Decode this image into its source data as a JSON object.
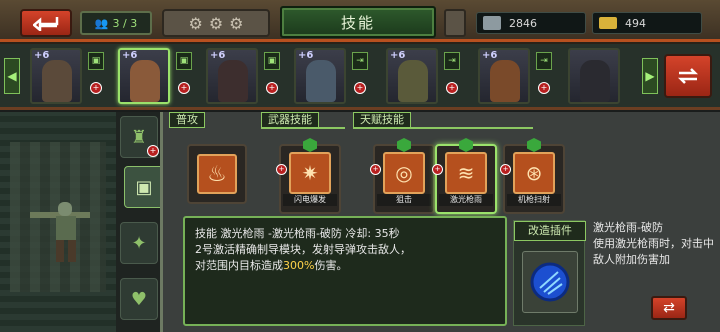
{
  "header": {
    "title": "技能",
    "squad_count": "3 / 3",
    "resources": [
      {
        "icon": "ammo-icon",
        "value": "2846"
      },
      {
        "icon": "gold-bar-icon",
        "value": "494"
      }
    ]
  },
  "heroes": [
    {
      "plus": "+6",
      "tag": "person",
      "dot": "+",
      "color": "#5b4a3a"
    },
    {
      "plus": "+6",
      "tag": "person",
      "dot": "+",
      "color": "#8a5a3a",
      "selected": true
    },
    {
      "plus": "+6",
      "tag": "person",
      "dot": "+",
      "color": "#3d2e2e"
    },
    {
      "plus": "+6",
      "tag": "exit",
      "dot": "+",
      "color": "#4a5a6a"
    },
    {
      "plus": "+6",
      "tag": "exit",
      "dot": "+",
      "color": "#5a5a3a"
    },
    {
      "plus": "+6",
      "tag": "exit",
      "dot": "+",
      "color": "#7a4a2a"
    }
  ],
  "categories": {
    "basic": "普攻",
    "weapon": "武器技能",
    "talent": "天赋技能"
  },
  "skills": [
    {
      "name": "闪电爆发",
      "glyph": "✷"
    },
    {
      "name": "狙击",
      "glyph": "◎"
    },
    {
      "name": "激光枪雨",
      "glyph": "≋"
    },
    {
      "name": "机枪扫射",
      "glyph": "⊛"
    }
  ],
  "description": {
    "line1_prefix": "技能 ",
    "line1_name": "激光枪雨 -激光枪雨-破防 冷却: ",
    "line1_cd": "35秒",
    "line2": "2号激活精确制导模块，发射导弹攻击敌人，",
    "line3_prefix": "对范围内目标造成",
    "line3_value": "300%",
    "line3_suffix": "伤害。"
  },
  "module": {
    "title": "改造插件",
    "name": "激光枪雨-破防",
    "text": "使用激光枪雨时，对击中敌人附加伤害加"
  }
}
